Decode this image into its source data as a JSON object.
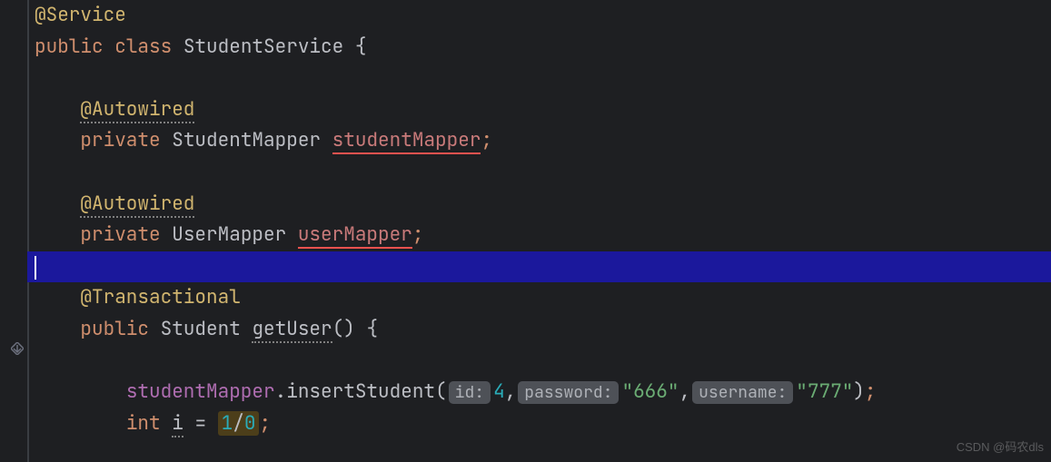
{
  "code": {
    "l1": {
      "annotation": "@Service"
    },
    "l2": {
      "kw_public": "public",
      "kw_class": "class",
      "className": "StudentService",
      "brace": " {"
    },
    "l3": {
      "blank": ""
    },
    "l4": {
      "annotation": "@Autowired"
    },
    "l5": {
      "kw_private": "private",
      "type": "StudentMapper",
      "field": "studentMapper",
      "semi": ";"
    },
    "l6": {
      "blank": ""
    },
    "l7": {
      "annotation": "@Autowired"
    },
    "l8": {
      "kw_private": "private",
      "type": "UserMapper",
      "field": "userMapper",
      "semi": ";"
    },
    "l9": {
      "blank": ""
    },
    "l10": {
      "annotation": "@Transactional"
    },
    "l11": {
      "kw_public": "public",
      "retType": "Student",
      "method": "getUser",
      "parens": "()",
      "brace": " {"
    },
    "l12": {
      "blank": ""
    },
    "l13": {
      "obj": "studentMapper",
      "dot": ".",
      "method": "insertStudent",
      "open": "(",
      "hint1": "id:",
      "arg1": "4",
      "comma1": ",",
      "hint2": "password:",
      "arg2": "\"666\"",
      "comma2": ",",
      "hint3": "username:",
      "arg3": "\"777\"",
      "close": ")",
      "semi": ";"
    },
    "l14": {
      "kw_int": "int",
      "var": "i",
      "eq": " = ",
      "expr_a": "1",
      "expr_op": "/",
      "expr_b": "0",
      "semi": ";"
    }
  },
  "watermark": "CSDN @码农dls"
}
